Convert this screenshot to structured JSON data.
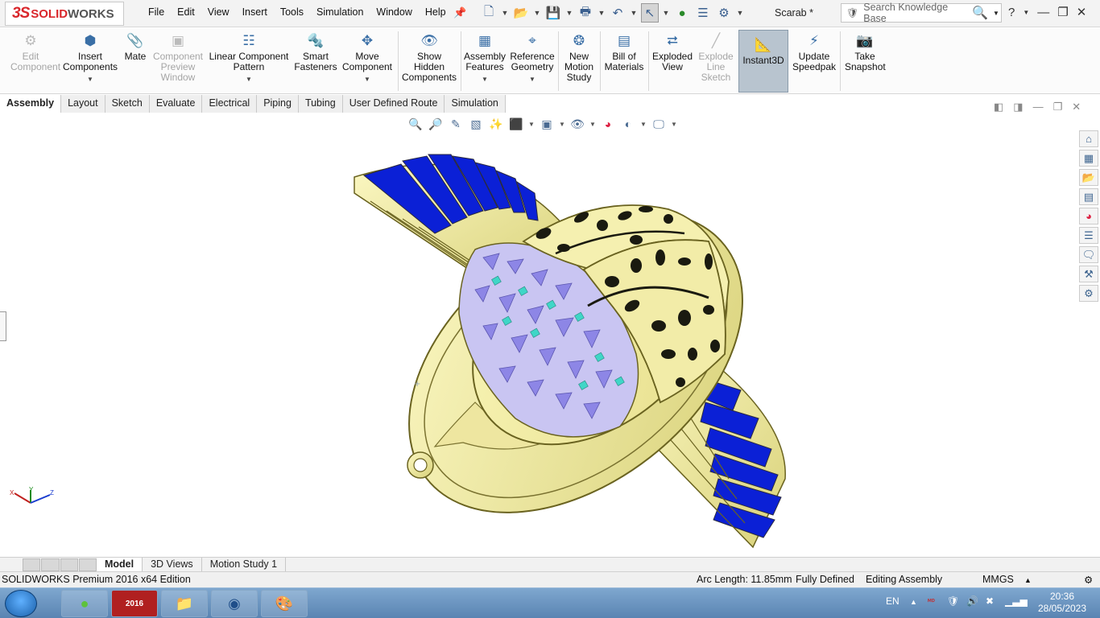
{
  "app": {
    "logo_prefix": "3S",
    "logo_name": "SOLID",
    "logo_name_bold": "WORKS",
    "document_title": "Scarab *"
  },
  "menu": [
    "File",
    "Edit",
    "View",
    "Insert",
    "Tools",
    "Simulation",
    "Window",
    "Help"
  ],
  "search": {
    "placeholder": "Search Knowledge Base"
  },
  "ribbon": {
    "edit_component": "Edit Component",
    "insert_components": "Insert Components",
    "mate": "Mate",
    "component_preview": "Component Preview Window",
    "linear_pattern": "Linear Component Pattern",
    "smart_fasteners": "Smart Fasteners",
    "move_component": "Move Component",
    "show_hidden": "Show Hidden Components",
    "assembly_features": "Assembly Features",
    "reference_geometry": "Reference Geometry",
    "new_motion_study": "New Motion Study",
    "bill_of_materials": "Bill of Materials",
    "exploded_view": "Exploded View",
    "explode_line_sketch": "Explode Line Sketch",
    "instant3d": "Instant3D",
    "update_speedpak": "Update Speedpak",
    "take_snapshot": "Take Snapshot"
  },
  "command_tabs": [
    "Assembly",
    "Layout",
    "Sketch",
    "Evaluate",
    "Electrical",
    "Piping",
    "Tubing",
    "User Defined Route",
    "Simulation"
  ],
  "bottom_tabs": [
    "Model",
    "3D Views",
    "Motion Study 1"
  ],
  "status": {
    "edition": "SOLIDWORKS Premium 2016 x64 Edition",
    "arc_length": "Arc Length: 11.85mm",
    "definition": "Fully Defined",
    "mode": "Editing Assembly",
    "units": "MMGS"
  },
  "taskbar": {
    "language": "EN",
    "time": "20:36",
    "date": "28/05/2023",
    "sw_label": "2016"
  },
  "colors": {
    "model_gold": "#f6f1a4",
    "model_blue": "#0b20d6",
    "model_purple": "#8d86e6",
    "model_teal": "#3fd6c7",
    "accent_red": "#d9262b"
  }
}
